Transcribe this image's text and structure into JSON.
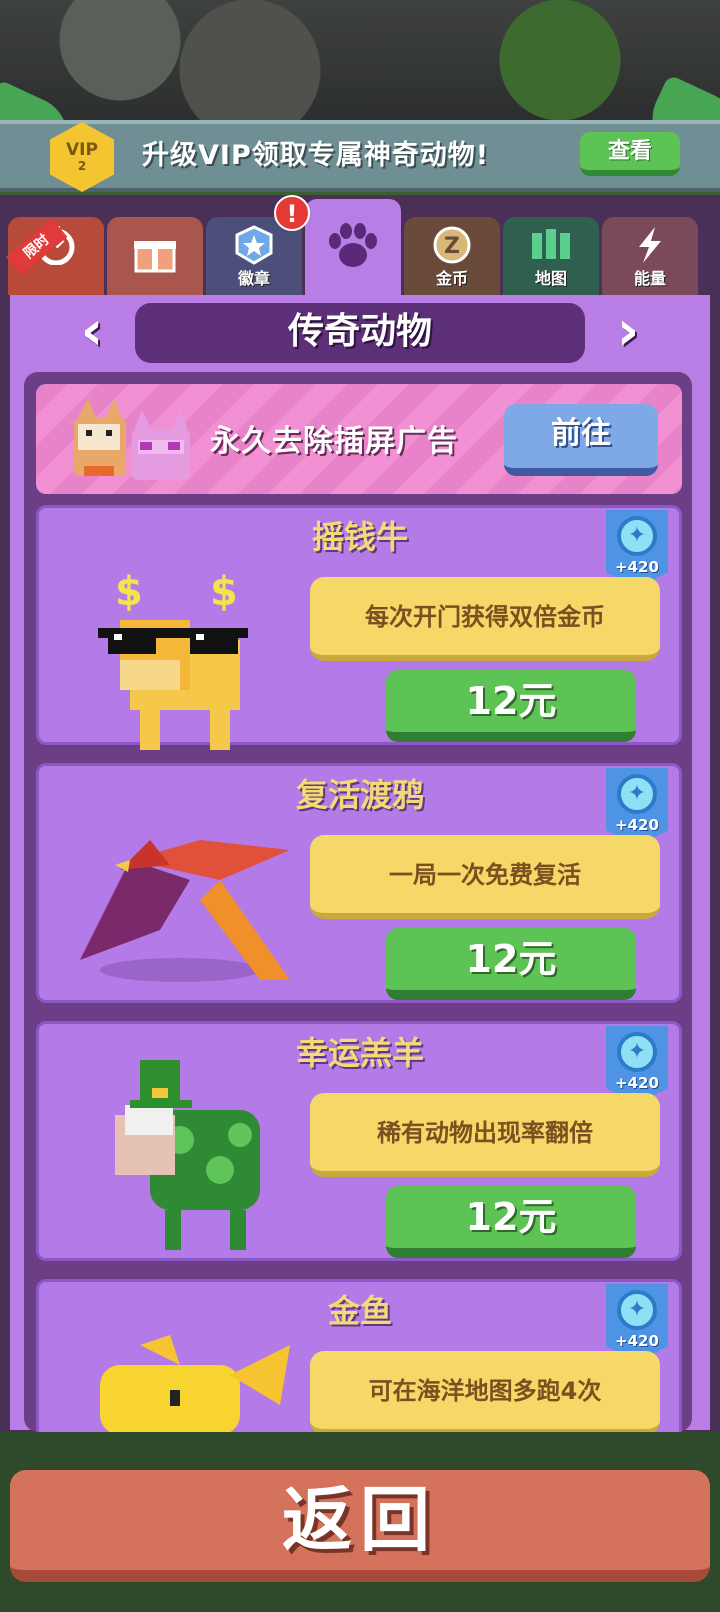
{
  "vip_banner": {
    "badge_text": "VIP",
    "badge_level": "2",
    "message": "升级VIP领取专属神奇动物!",
    "view_label": "查看"
  },
  "tabs": [
    {
      "id": "limited",
      "label": "",
      "ribbon": "限时",
      "icon": "stopwatch-icon",
      "color": "#b84a3a"
    },
    {
      "id": "gift",
      "label": "",
      "icon": "gift-icon",
      "color": "#a9564e"
    },
    {
      "id": "badge",
      "label": "徽章",
      "icon": "badge-icon",
      "color": "#4b4f7a"
    },
    {
      "id": "animals",
      "label": "",
      "icon": "paw-icon",
      "color": "#b87ee6",
      "active": true,
      "alert": "!"
    },
    {
      "id": "coins",
      "label": "金币",
      "icon": "coin-icon",
      "color": "#6a4a3a"
    },
    {
      "id": "map",
      "label": "地图",
      "icon": "map-icon",
      "color": "#2f5f4e"
    },
    {
      "id": "energy",
      "label": "能量",
      "icon": "lightning-icon",
      "color": "#7a4a5a"
    }
  ],
  "section_title": "传奇动物",
  "ad_removal": {
    "text": "永久去除插屏广告",
    "button": "前往"
  },
  "animals": [
    {
      "name": "摇钱牛",
      "points": "+420",
      "description": "每次开门获得双倍金币",
      "price": "12元"
    },
    {
      "name": "复活渡鸦",
      "points": "+420",
      "description": "一局一次免费复活",
      "price": "12元"
    },
    {
      "name": "幸运羔羊",
      "points": "+420",
      "description": "稀有动物出现率翻倍",
      "price": "12元"
    },
    {
      "name": "金鱼",
      "points": "+420",
      "description": "可在海洋地图多跑4次",
      "price": ""
    }
  ],
  "back_label": "返回"
}
